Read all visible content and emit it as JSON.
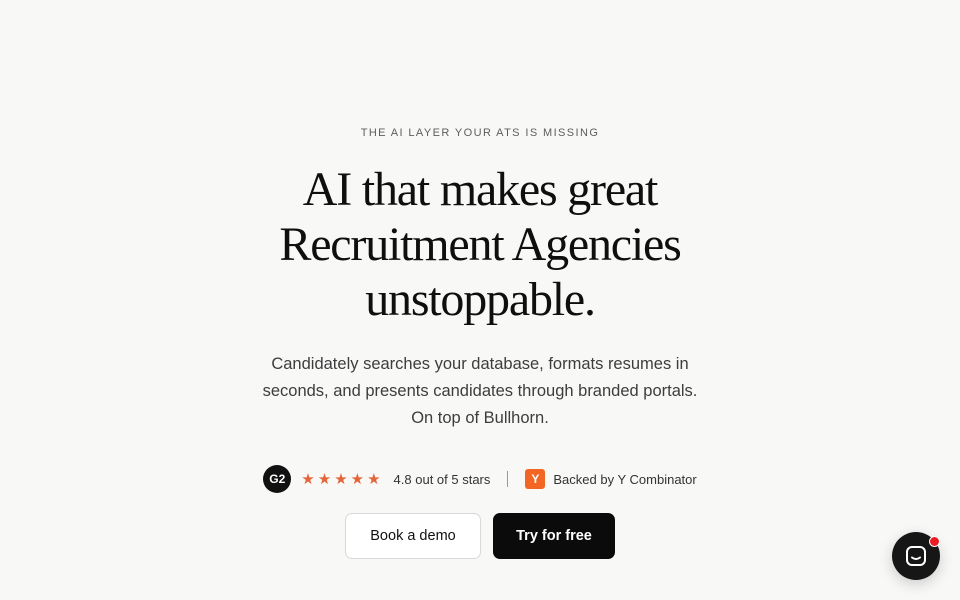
{
  "hero": {
    "eyebrow": "THE AI LAYER YOUR ATS IS MISSING",
    "headline_lines": [
      "AI that makes great",
      "Recruitment Agencies",
      "unstoppable."
    ],
    "subtitle": "Candidately searches your database, formats resumes in seconds, and presents candidates through branded portals. On top of Bullhorn."
  },
  "social_proof": {
    "g2_badge": "G2",
    "star_icon": "star-icon",
    "star_count": 5,
    "rating_text": "4.8 out of 5 stars",
    "yc_logo": "Y",
    "backed_text": "Backed by Y Combinator"
  },
  "cta": {
    "demo_label": "Book a demo",
    "trial_label": "Try for free"
  },
  "chat": {
    "icon": "chat-bubble-icon",
    "notification": "notification-dot"
  },
  "colors": {
    "background": "#f8f8f7",
    "star": "#e4653a",
    "yc_orange": "#f26522",
    "primary_button": "#0b0b0b",
    "chat_notification": "#ec1c24"
  }
}
